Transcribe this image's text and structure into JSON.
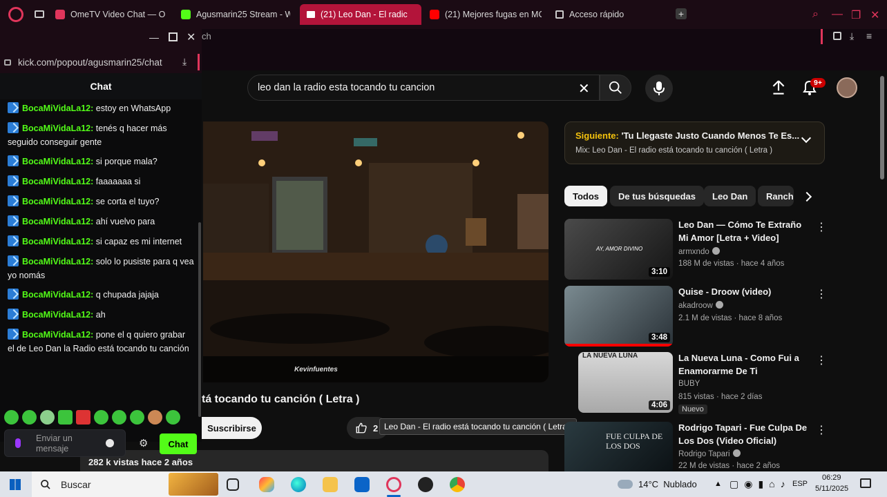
{
  "browser": {
    "tabs": [
      {
        "label": "OmeTV Video Chat — Om",
        "color": "#e0355b"
      },
      {
        "label": "Agusmarin25 Stream - W",
        "color": "#53fc18"
      },
      {
        "label": "(21) Leo Dan - El radic",
        "color": "#ff0000"
      },
      {
        "label": "(21) Mejores fugas en MC",
        "color": "#ff0000"
      },
      {
        "label": "Acceso rápido",
        "color": "#cccccc"
      }
    ],
    "partial_text": "ch"
  },
  "popout": {
    "url": "kick.com/popout/agusmarin25/chat",
    "chat_title": "Chat",
    "messages": [
      {
        "user": "BocaMiVidaLa12:",
        "text": "estoy en WhatsApp"
      },
      {
        "user": "BocaMiVidaLa12:",
        "text": "tenés q hacer más seguido conseguir gente"
      },
      {
        "user": "BocaMiVidaLa12:",
        "text": "si porque mala?"
      },
      {
        "user": "BocaMiVidaLa12:",
        "text": "faaaaaaa si"
      },
      {
        "user": "BocaMiVidaLa12:",
        "text": "se corta el tuyo?"
      },
      {
        "user": "BocaMiVidaLa12:",
        "text": "ahí vuelvo para"
      },
      {
        "user": "BocaMiVidaLa12:",
        "text": "si capaz es mi internet"
      },
      {
        "user": "BocaMiVidaLa12:",
        "text": "solo lo pusiste para q vea yo nomás"
      },
      {
        "user": "BocaMiVidaLa12:",
        "text": "q chupada jajaja"
      },
      {
        "user": "BocaMiVidaLa12:",
        "text": "ah"
      },
      {
        "user": "BocaMiVidaLa12:",
        "text": "pone el q quiero grabar el de Leo Dan la Radio está tocando tu canción"
      }
    ],
    "input_placeholder": "Enviar un mensaje",
    "send_label": "Chat"
  },
  "youtube": {
    "search_value": "leo dan la radio esta tocando tu cancion",
    "notification_count": "9+",
    "video_watermark": "Kevinfuentes",
    "video_title_partial": "tá tocando tu canción ( Letra )",
    "subscribe_label": "Suscribirse",
    "like_count": "2",
    "tooltip": "Leo Dan - El radio está tocando tu canción ( Letra )",
    "views_info": "282 k vistas  hace 2 años",
    "next_up": {
      "label": "Siguiente:",
      "title": "'Tu Llegaste Justo Cuando Menos Te Es...",
      "mix": "Mix: Leo Dan - El radio está tocando tu canción ( Letra )"
    },
    "chips": [
      "Todos",
      "De tus búsquedas",
      "Leo Dan",
      "Ranch"
    ],
    "recommendations": [
      {
        "title": "Leo Dan — Cómo Te Extraño Mi Amor [Letra + Video]",
        "channel": "armxndo",
        "verified": true,
        "meta": "188 M de vistas · hace 4 años",
        "duration": "3:10",
        "thumb_text": "AY, AMOR DIVINO",
        "badge": ""
      },
      {
        "title": "Quise - Droow (video)",
        "channel": "akadroow",
        "verified": true,
        "meta": "2.1 M de vistas · hace 8 años",
        "duration": "3:48",
        "thumb_text": "",
        "badge": ""
      },
      {
        "title": "La Nueva Luna - Como Fui a Enamorarme De Ti",
        "channel": "BUBY",
        "verified": false,
        "meta": "815 vistas · hace 2 días",
        "duration": "4:06",
        "thumb_text": "LA NUEVA LUNA",
        "badge": "Nuevo"
      },
      {
        "title": "Rodrigo Tapari - Fue Culpa De Los Dos (Video Oficial)",
        "channel": "Rodrigo Tapari",
        "verified": true,
        "meta": "22 M de vistas · hace 2 años",
        "duration": "",
        "thumb_text": "FUE CULPA DE LOS DOS",
        "badge": ""
      }
    ]
  },
  "taskbar": {
    "search_label": "Buscar",
    "weather": "14°C  Nublado",
    "lang": "ESP",
    "time": "06:29",
    "date": "5/11/2025"
  }
}
